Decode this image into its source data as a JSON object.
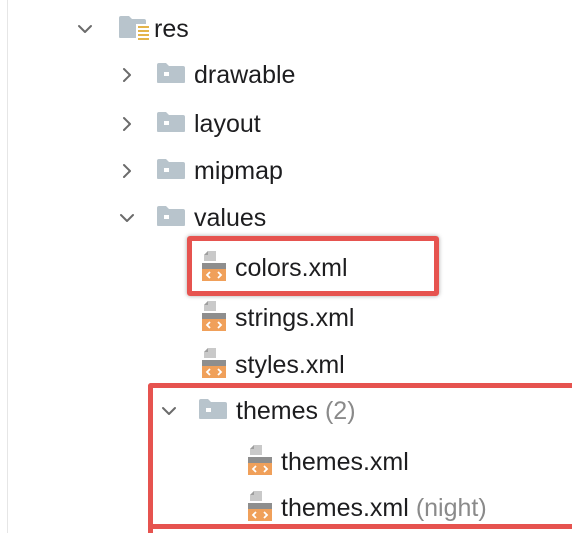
{
  "tree": {
    "res": {
      "label": "res"
    },
    "drawable": {
      "label": "drawable"
    },
    "layout": {
      "label": "layout"
    },
    "mipmap": {
      "label": "mipmap"
    },
    "values": {
      "label": "values"
    },
    "files": {
      "colors": {
        "label": "colors.xml"
      },
      "strings": {
        "label": "strings.xml"
      },
      "styles": {
        "label": "styles.xml"
      }
    },
    "themes": {
      "label": "themes",
      "count": "(2)",
      "files": [
        {
          "label": "themes.xml",
          "qualifier": ""
        },
        {
          "label": "themes.xml",
          "qualifier": "(night)"
        }
      ]
    }
  },
  "colors": {
    "highlight_border": "#e6534f",
    "folder_fill": "#b8c4cc",
    "xml_icon_orange": "#f0a05a"
  },
  "icons": {
    "expanded": "chevron-down-icon",
    "collapsed": "chevron-right-icon",
    "folder": "folder-icon",
    "resource_folder": "resource-folder-icon",
    "xml_file": "xml-file-icon"
  }
}
